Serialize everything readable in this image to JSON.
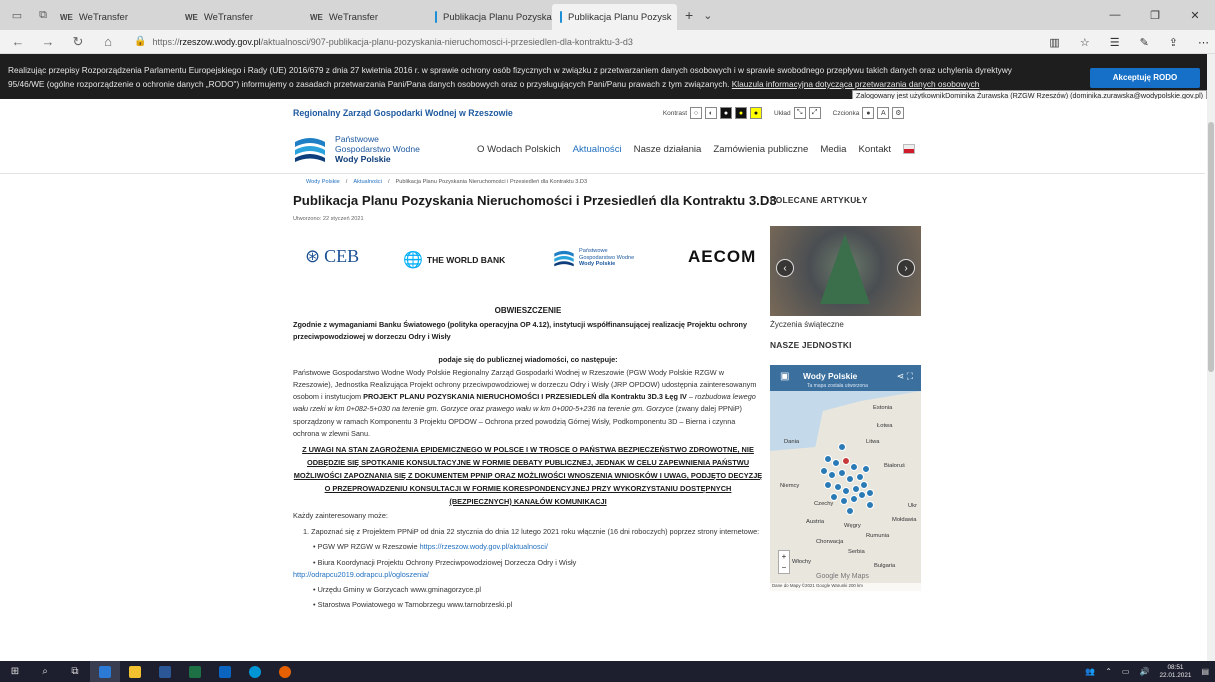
{
  "browser": {
    "tabs": [
      {
        "label": "WeTransfer",
        "icon": "WE"
      },
      {
        "label": "WeTransfer",
        "icon": "WE"
      },
      {
        "label": "WeTransfer",
        "icon": "WE"
      },
      {
        "label": "Publikacja Planu Pozyskania",
        "icon": "doc"
      },
      {
        "label": "Publikacja Planu Pozysk",
        "icon": "doc"
      }
    ],
    "url_prefix": "https://",
    "url_host": "rzeszow.wody.gov.pl",
    "url_path": "/aktualnosci/907-publikacja-planu-pozyskania-nieruchomosci-i-przesiedlen-dla-kontraktu-3-d3"
  },
  "cookie": {
    "line1": "Realizując przepisy Rozporządzenia Parlamentu Europejskiego i Rady (UE) 2016/679 z dnia 27 kwietnia 2016 r. w sprawie ochrony osób fizycznych w związku z przetwarzaniem danych osobowych i w sprawie swobodnego przepływu takich danych oraz uchylenia dyrektywy",
    "line2": "95/46/WE (ogólne rozporządzenie o ochronie danych „RODO\") informujemy o zasadach przetwarzania Pani/Pana danych osobowych oraz o przysługujących Pani/Panu prawach z tym związanych.",
    "link": "Klauzula informacyjna dotycząca przetwarzania danych osobowych",
    "button": "Akceptuję RODO",
    "tooltip": "Zalogowany jest użytkownikDominika Żurawska (RZGW Rzeszów) (dominika.zurawska@wodypolskie.gov.pl)"
  },
  "topstrip": {
    "org": "Regionalny Zarząd Gospodarki Wodnej w Rzeszowie",
    "kontrast": "Kontrast",
    "uklad": "Układ",
    "czcionka": "Czcionka"
  },
  "logo": {
    "l1": "Państwowe",
    "l2": "Gospodarstwo Wodne",
    "l3": "Wody Polskie"
  },
  "nav": [
    "O Wodach Polskich",
    "Aktualności",
    "Nasze działania",
    "Zamówienia publiczne",
    "Media",
    "Kontakt"
  ],
  "breadcrumb": {
    "home": "Wody Polskie",
    "sep": "/",
    "section": "Aktualności",
    "current": "Publikacja Planu Pozyskania Nieruchomości i Przesiedleń dla Kontraktu 3.D3"
  },
  "article": {
    "title": "Publikacja Planu Pozyskania Nieruchomości i Przesiedleń dla Kontraktu 3.D3",
    "date": "Utworzono: 22 styczeń 2021",
    "logos": {
      "ceb": "CEB",
      "wb": "THE WORLD BANK",
      "pgw_l1": "Państwowe",
      "pgw_l2": "Gospodarstwo Wodne",
      "pgw_l3": "Wody Polskie",
      "aecom": "AECOM"
    },
    "heading": "OBWIESZCZENIE",
    "intro": "Zgodnie z wymaganiami Banku Światowego (polityka operacyjna OP 4.12), instytucji współfinansującej realizację Projektu ochrony przeciwpowodziowej w dorzeczu Odry i Wisły",
    "sub": "podaje się do publicznej wiadomości, co następuje:",
    "p1a": "Państwowe Gospodarstwo Wodne Wody Polskie Regionalny Zarząd Gospodarki Wodnej w Rzeszowie (PGW Wody Polskie RZGW w Rzeszowie), Jednostka Realizująca Projekt ochrony przeciwpowodziowej w dorzeczu Odry i Wisły (JRP OPDOW) udostępnia zainteresowanym osobom i instytucjom",
    "p1b": "PROJEKT PLANU POZYSKANIA NIERUCHOMOŚCI I PRZESIEDLEŃ dla Kontraktu 3D.3 Łęg IV",
    "p1c": "– rozbudowa lewego wału rzeki w km 0+082-5+030 na terenie gm. Gorzyce oraz prawego wału w km 0+000-5+236 na terenie gm. Gorzyce",
    "p1d": "(zwany dalej PPNiP) sporządzony w ramach Komponentu 3 Projektu OPDOW – Ochrona przed powodzią Górnej Wisły, Podkomponentu 3D – Bierna i czynna ochrona w zlewni Sanu.",
    "caps": "Z UWAGI NA STAN ZAGROŻENIA EPIDEMICZNEGO W POLSCE I W TROSCE O PAŃSTWA BEZPIECZEŃSTWO ZDROWOTNE, NIE ODBĘDZIE SIĘ SPOTKANIE KONSULTACYJNE W FORMIE DEBATY PUBLICZNEJ, JEDNAK W CELU ZAPEWNIENIA PAŃSTWU MOŻLIWOŚCI ZAPOZNANIA SIĘ Z DOKUMENTEM PPNIP ORAZ MOŻLIWOŚCI WNOSZENIA WNIOSKÓW I UWAG, PODJĘTO DECYZJĘ O PRZEPROWADZENIU KONSULTACJI W FORMIE KORESPONDENCYJNEJ PRZY WYKORZYSTANIU DOSTĘPNYCH (BEZPIECZNYCH) KANAŁÓW KOMUNIKACJI",
    "kazdy": "Każdy zainteresowany może:",
    "item1": "1. Zapoznać się z Projektem PPNiP od dnia 22 stycznia do dnia 12 lutego 2021 roku włącznie (16 dni roboczych) poprzez strony internetowe:",
    "b1": "• PGW WP RZGW w Rzeszowie",
    "b1link": "https://rzeszow.wody.gov.pl/aktualnosci/",
    "b2": "• Biura Koordynacji Projektu Ochrony Przeciwpowodziowej Dorzecza Odry i Wisły",
    "b2link": "http://odrapcu2019.odrapcu.pl/ogloszenia/",
    "b3": "• Urzędu Gminy w Gorzycach www.gminagorzyce.pl",
    "b4": "• Starostwa Powiatowego w Tarnobrzegu www.tarnobrzeski.pl"
  },
  "sidebar": {
    "polecane": "POLECANE ARTYKUŁY",
    "caption": "Życzenia świąteczne",
    "jednostki": "NASZE JEDNOSTKI",
    "map_title": "Wody Polskie",
    "map_sub": "Ta mapa została utworzona",
    "labels": [
      "Estonia",
      "Łotwa",
      "Litwa",
      "Dania",
      "Białoruś",
      "Niemcy",
      "Czechy",
      "Austria",
      "Węgry",
      "Rumunia",
      "Chorwacja",
      "Serbia",
      "Włochy",
      "Bulgaria",
      "Mołdawia",
      "Ukr"
    ],
    "google": "Google My Maps",
    "footer": "Dane do Mapy ©2021 Google   Warunki   200 km"
  },
  "taskbar": {
    "time": "08:51",
    "date": "22.01.2021"
  }
}
